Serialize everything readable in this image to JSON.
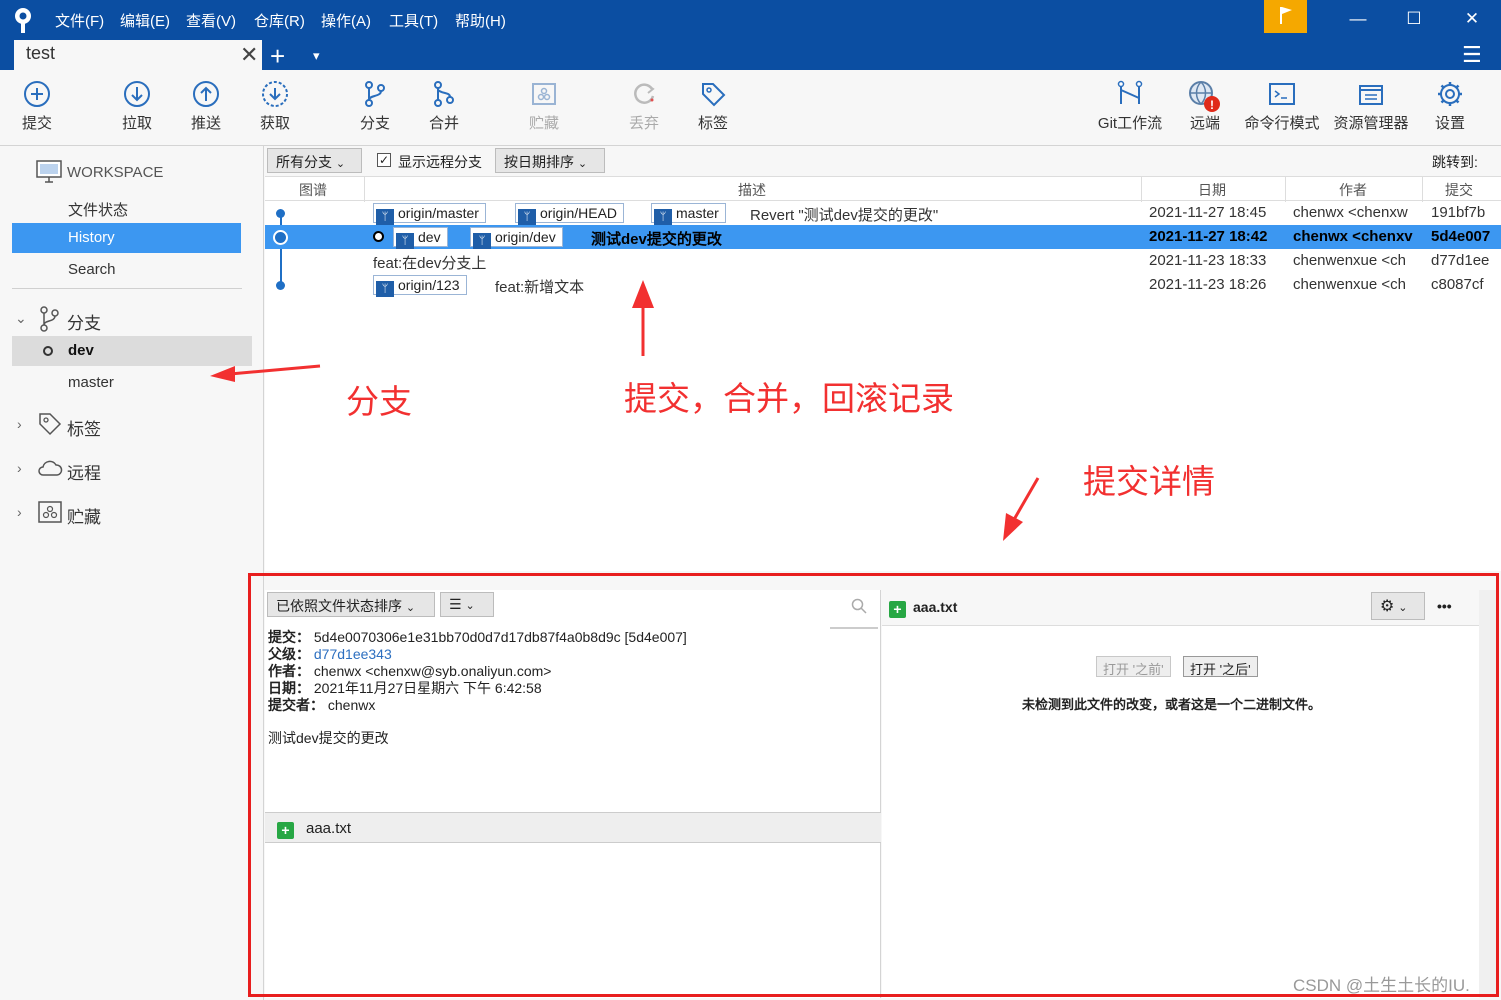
{
  "menu": [
    "文件(F)",
    "编辑(E)",
    "查看(V)",
    "仓库(R)",
    "操作(A)",
    "工具(T)",
    "帮助(H)"
  ],
  "tab": {
    "title": "test",
    "close": "✕",
    "add": "+",
    "dropdown": "▾"
  },
  "window_controls": {
    "minimize": "—",
    "maximize": "☐",
    "close": "✕"
  },
  "toolbar": {
    "commit": "提交",
    "pull": "拉取",
    "push": "推送",
    "fetch": "获取",
    "branch": "分支",
    "merge": "合并",
    "stash": "贮藏",
    "discard": "丢弃",
    "tag": "标签",
    "gitflow": "Git工作流",
    "remote": "远端",
    "terminal": "命令行模式",
    "explorer": "资源管理器",
    "settings": "设置"
  },
  "sidebar": {
    "workspace": "WORKSPACE",
    "file_status": "文件状态",
    "history": "History",
    "search": "Search",
    "branches": "分支",
    "branch_items": [
      "dev",
      "master"
    ],
    "tags": "标签",
    "remotes": "远程",
    "stashes": "贮藏"
  },
  "filters": {
    "branch_filter": "所有分支",
    "show_remote": "显示远程分支",
    "sort": "按日期排序",
    "jump_to": "跳转到:"
  },
  "columns": {
    "graph": "图谱",
    "description": "描述",
    "date": "日期",
    "author": "作者",
    "commit": "提交"
  },
  "commits": [
    {
      "tags": [
        "origin/master",
        "origin/HEAD",
        "master"
      ],
      "message": "Revert \"测试dev提交的更改\"",
      "date": "2021-11-27 18:45",
      "author": "chenwx <chenxw",
      "hash": "191bf7b"
    },
    {
      "tags": [
        "dev",
        "origin/dev"
      ],
      "message": "测试dev提交的更改",
      "date": "2021-11-27 18:42",
      "author": "chenwx <chenxv",
      "hash": "5d4e007"
    },
    {
      "tags": [],
      "message": "feat:在dev分支上",
      "date": "2021-11-23 18:33",
      "author": "chenwenxue <ch",
      "hash": "d77d1ee"
    },
    {
      "tags": [
        "origin/123"
      ],
      "message": "feat:新增文本",
      "date": "2021-11-23 18:26",
      "author": "chenwenxue <ch",
      "hash": "c8087cf"
    }
  ],
  "annotations": {
    "branch": "分支",
    "commits": "提交，合并，回滚记录",
    "details": "提交详情"
  },
  "detail": {
    "sort": "已依照文件状态排序",
    "list_icon": "☰",
    "commit_label": "提交：",
    "commit_value": "5d4e0070306e1e31bb70d0d7d17db87f4a0b8d9c [5d4e007]",
    "parent_label": "父级：",
    "parent_value": "d77d1ee343",
    "author_label": "作者：",
    "author_value": "chenwx <chenxw@syb.onaliyun.com>",
    "date_label": "日期：",
    "date_value": "2021年11月27日星期六 下午 6:42:58",
    "committer_label": "提交者：",
    "committer_value": "chenwx",
    "message": "测试dev提交的更改",
    "file": "aaa.txt",
    "right_file": "aaa.txt",
    "open_before": "打开 '之前'",
    "open_after": "打开 '之后'",
    "binary_note": "未检测到此文件的改变，或者这是一个二进制文件。",
    "more": "•••"
  },
  "watermark": "CSDN @土生土长的IU.",
  "colors": {
    "titlebar": "#0b4ea2",
    "selection": "#3c97f1",
    "annotation": "#f23030",
    "flag": "#f5a800"
  }
}
